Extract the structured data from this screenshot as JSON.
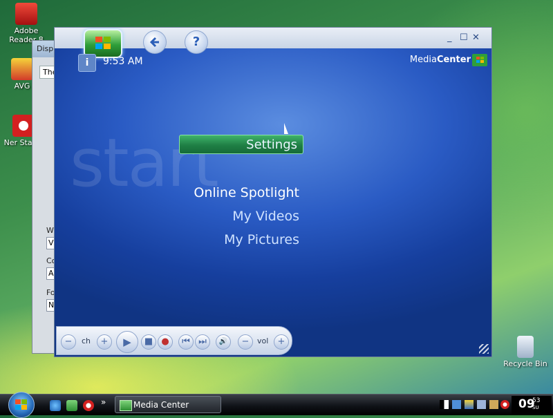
{
  "desktop": {
    "icons": [
      {
        "label": "Adobe Reader 8",
        "icon": "adobe-reader-icon"
      },
      {
        "label": "AVG",
        "icon": "avg-icon"
      },
      {
        "label": "Ner StartS",
        "icon": "nero-startsmart-icon"
      },
      {
        "label": "Recycle Bin",
        "icon": "recycle-bin-icon"
      }
    ]
  },
  "background_window": {
    "title": "Disp",
    "tab": "The",
    "labels": [
      "W",
      "Co",
      "Fo"
    ],
    "fields": [
      "V",
      "A",
      "N"
    ]
  },
  "media_center": {
    "controls": {
      "minimize": "_",
      "maximize": "☐",
      "close": "✕"
    },
    "back_icon": "back-arrow-icon",
    "help_label": "?",
    "info_label": "i",
    "time": "9:53 AM",
    "brand": {
      "prefix": "Media",
      "suffix": "Center"
    },
    "background_word": "start",
    "menu": {
      "selected": "Settings",
      "items": [
        "Online Spotlight",
        "My Videos",
        "My Pictures"
      ]
    },
    "transport": {
      "ch_label": "ch",
      "vol_label": "vol",
      "ch_minus": "−",
      "ch_plus": "+",
      "play": "▶",
      "stop": "■",
      "record": "●",
      "prev": "⏮",
      "next": "⏭",
      "mute": "🔊",
      "vol_minus": "−",
      "vol_plus": "+"
    }
  },
  "taskbar": {
    "task_label": "Media Center",
    "quick_launch_more": "»",
    "clock": {
      "hour": "09",
      "minutes": "53",
      "day": "SU"
    }
  },
  "colors": {
    "accent_green": "#2f9f3a",
    "mc_blue": "#2a5bc4",
    "selection_green": "#1f7f45"
  }
}
